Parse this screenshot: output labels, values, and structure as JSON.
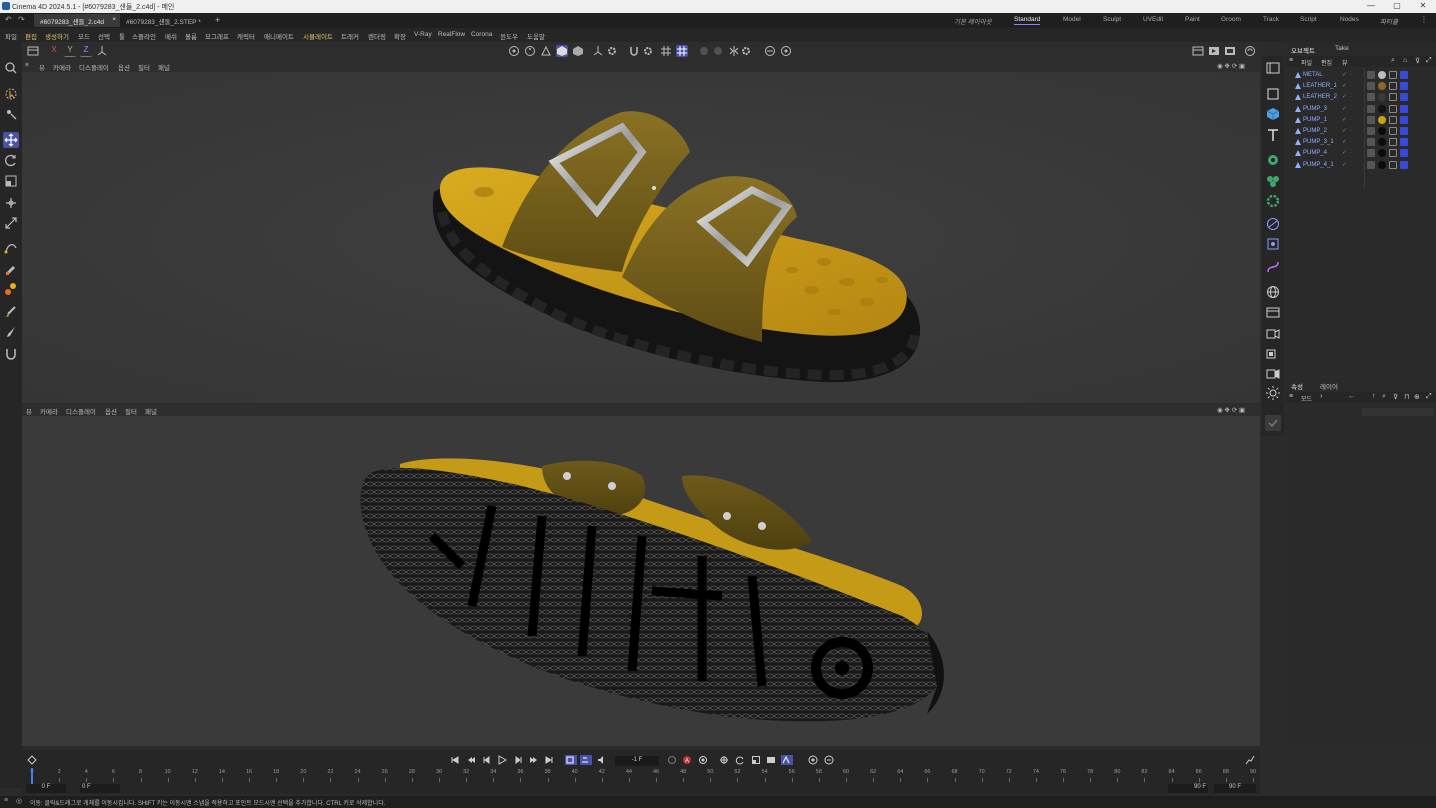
{
  "window": {
    "title": "Cinema 4D 2024.5.1 - [#6079283_샌들_2.c4d] - 메인",
    "controls": [
      "—",
      "▢",
      "✕"
    ]
  },
  "tabs": {
    "doc1": "#6079283_샌들_2.c4d",
    "doc1_close": "×",
    "doc2": "#6079283_샌들_2.STEP *",
    "add": "+",
    "layouts": [
      "기본 레이아웃",
      "Standard",
      "Model",
      "Sculpt",
      "UVEdit",
      "Paint",
      "Groom",
      "Track",
      "Script",
      "Nodes",
      "파티클"
    ],
    "active_layout": "Standard"
  },
  "menu": [
    "파일",
    "편집",
    "생성하기",
    "모드",
    "선택",
    "툴",
    "스플라인",
    "메쉬",
    "볼륨",
    "모그래프",
    "캐릭터",
    "애니메이트",
    "시뮬레이트",
    "트래커",
    "렌더링",
    "확장",
    "V-Ray",
    "RealFlow",
    "Corona",
    "윈도우",
    "도움말"
  ],
  "axis_buttons": [
    "X",
    "Y",
    "Z"
  ],
  "viewport_menu": [
    "뷰",
    "카메라",
    "디스플레이",
    "옵션",
    "필터",
    "패널"
  ],
  "object_manager": {
    "tabs": [
      "오브젝트",
      "Take"
    ],
    "menu": [
      "파일",
      "편집",
      "뷰"
    ],
    "objects": [
      {
        "name": "METAL",
        "mat": "#bdbdbd"
      },
      {
        "name": "LEATHER_1",
        "mat": "#8a6b1e"
      },
      {
        "name": "LEATHER_2",
        "mat": "#3a3a3a"
      },
      {
        "name": "PUMP_3",
        "mat": "#111111"
      },
      {
        "name": "PUMP_1",
        "mat": "#c9a21a"
      },
      {
        "name": "PUMP_2",
        "mat": "#0c0c0c"
      },
      {
        "name": "PUMP_3_1",
        "mat": "#0c0c0c"
      },
      {
        "name": "PUMP_4",
        "mat": "#0c0c0c"
      },
      {
        "name": "PUMP_4_1",
        "mat": "#0c0c0c"
      }
    ]
  },
  "attributes": {
    "tabs": [
      "속성",
      "레이어"
    ],
    "mode": "모드"
  },
  "timeline": {
    "current_frame": "-1 F",
    "start_label": "0 F",
    "start_field": "0 F",
    "end_field": "90 F",
    "end_label": "90 F",
    "ticks": [
      0,
      2,
      4,
      6,
      8,
      10,
      12,
      14,
      16,
      18,
      20,
      22,
      24,
      26,
      28,
      30,
      32,
      34,
      36,
      38,
      40,
      42,
      44,
      46,
      48,
      50,
      52,
      54,
      56,
      58,
      60,
      62,
      64,
      66,
      68,
      70,
      72,
      74,
      76,
      78,
      80,
      82,
      84,
      86,
      88,
      90
    ]
  },
  "status": "이동: 클릭&드래그로 개체를 이동시킵니다. SHIFT 키는 이동시엔 스냅을 적용하고 포인트 모드시엔 선택을 추가합니다. CTRL 키로 삭제합니다.",
  "colors": {
    "accent": "#5a63d8",
    "leather": "#7a6420",
    "footbed": "#c49a16",
    "sole": "#151515",
    "buckle": "#d8d8d8"
  }
}
